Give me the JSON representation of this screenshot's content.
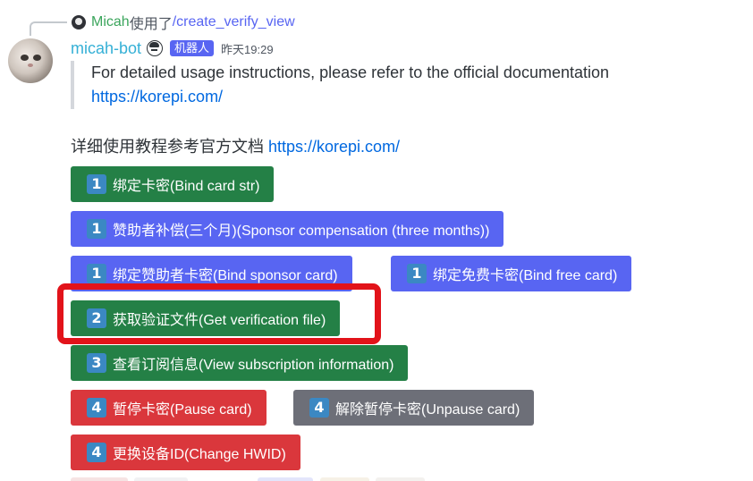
{
  "reply": {
    "user": "Micah",
    "text": "使用了",
    "command": "/create_verify_view"
  },
  "message": {
    "author": "micah-bot",
    "bot_tag": "机器人",
    "timestamp": "昨天19:29",
    "quote_line1": "For detailed usage instructions, please refer to the official documentation",
    "quote_link": "https://korepi.com/",
    "desc_text": "详细使用教程参考官方文档 ",
    "desc_link": "https://korepi.com/"
  },
  "buttons": [
    {
      "key": "1",
      "label": "绑定卡密(Bind card str)",
      "color": "green"
    },
    {
      "key": "1",
      "label": "赞助者补偿(三个月)(Sponsor compensation (three months))",
      "color": "blurple"
    },
    {
      "key": "1",
      "label": "绑定赞助者卡密(Bind sponsor card)",
      "color": "blurple"
    },
    {
      "key": "1",
      "label": "绑定免费卡密(Bind free card)",
      "color": "blurple"
    },
    {
      "key": "2",
      "label": "获取验证文件(Get verification file)",
      "color": "green"
    },
    {
      "key": "3",
      "label": "查看订阅信息(View subscription information)",
      "color": "green"
    },
    {
      "key": "4",
      "label": "暂停卡密(Pause card)",
      "color": "red"
    },
    {
      "key": "4",
      "label": "解除暂停卡密(Unpause card)",
      "color": "grey"
    },
    {
      "key": "4",
      "label": "更换设备ID(Change HWID)",
      "color": "red"
    }
  ],
  "colors": {
    "green": "#248046",
    "blurple": "#5865f2",
    "red": "#da373c",
    "grey": "#6d6f78",
    "highlight": "#e2131a",
    "username": "#35b0d6",
    "link": "#0068e0"
  },
  "icons": {
    "keycap": "keycap-digit-icon",
    "author_badge": "glasses-face-icon"
  }
}
